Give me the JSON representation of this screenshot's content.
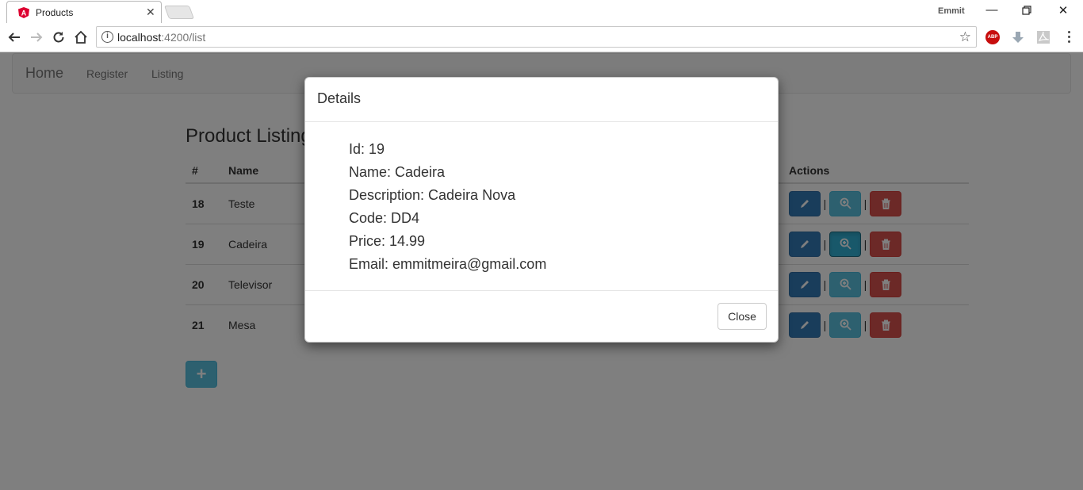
{
  "browser": {
    "tab_title": "Products",
    "profile_name": "Emmit",
    "url_host": "localhost",
    "url_path": ":4200/list",
    "extension_abp_label": "ABP",
    "colors": {
      "angular_red": "#dd0031",
      "abp_red": "#c70d0d"
    }
  },
  "navbar": {
    "brand": "Home",
    "links": [
      "Register",
      "Listing"
    ]
  },
  "listing": {
    "title": "Product Listing",
    "columns": {
      "id": "#",
      "name": "Name",
      "actions": "Actions"
    },
    "rows": [
      {
        "id": "18",
        "name": "Teste"
      },
      {
        "id": "19",
        "name": "Cadeira"
      },
      {
        "id": "20",
        "name": "Televisor"
      },
      {
        "id": "21",
        "name": "Mesa"
      }
    ],
    "separator": "|",
    "add_button": "+",
    "colors": {
      "edit": "#337ab7",
      "view": "#5bc0de",
      "delete": "#d9534f"
    }
  },
  "modal": {
    "title": "Details",
    "details": [
      "Id: 19",
      "Name: Cadeira",
      "Description: Cadeira Nova",
      "Code: DD4",
      "Price: 14.99",
      "Email: emmitmeira@gmail.com"
    ],
    "close_label": "Close"
  }
}
